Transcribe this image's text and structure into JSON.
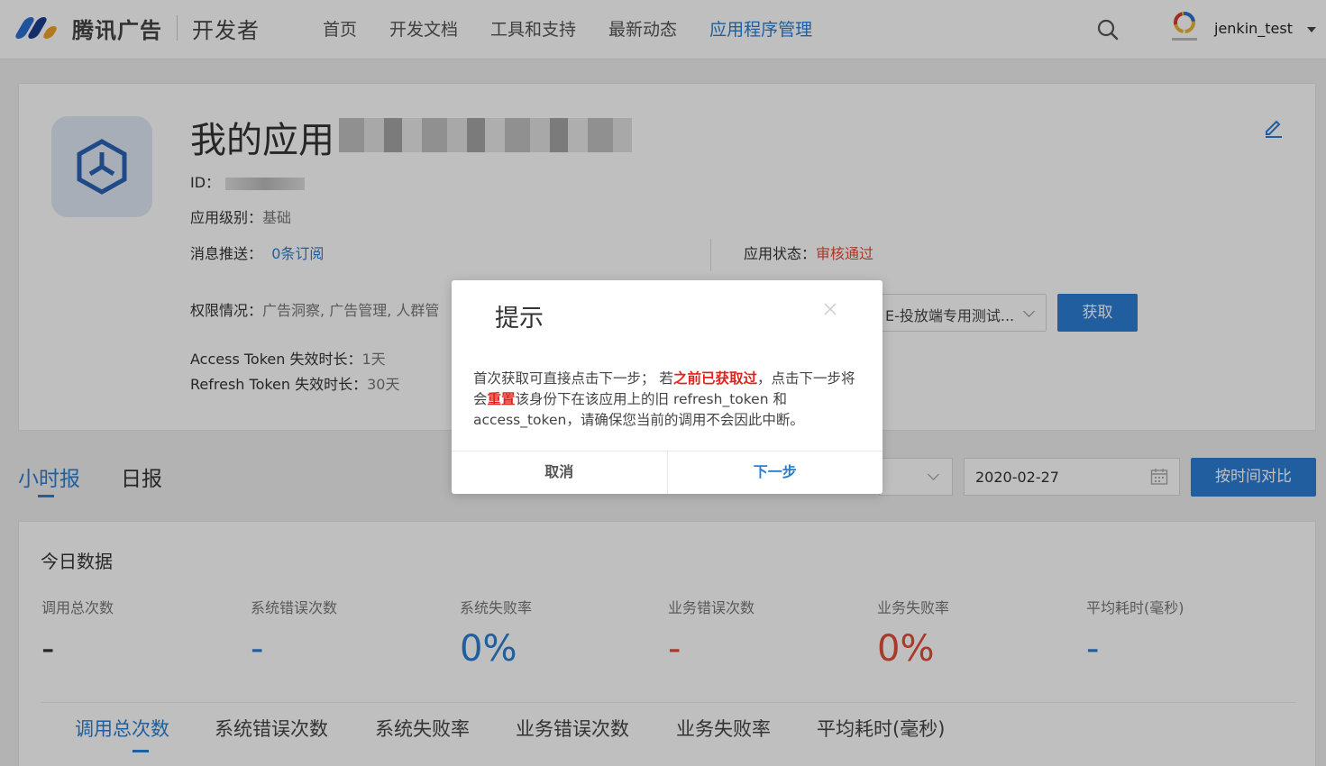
{
  "header": {
    "brand": "腾讯广告",
    "sub_brand": "开发者",
    "nav": [
      "首页",
      "开发文档",
      "工具和支持",
      "最新动态",
      "应用程序管理"
    ],
    "active_nav_index": 4,
    "username": "jenkin_test"
  },
  "app": {
    "title_prefix": "我的应用",
    "id_label": "ID：",
    "level_label": "应用级别：",
    "level_value": "基础",
    "push_label": "消息推送：",
    "push_value": "0条订阅",
    "status_label": "应用状态：",
    "status_value": "审核通过",
    "perm_label": "权限情况：",
    "perm_value": "广告洞察, 广告管理, 人群管",
    "account_select": "E-投放端专用测试...",
    "fetch_button": "获取",
    "access_token_label": "Access Token 失效时长：",
    "access_token_value": "1天",
    "refresh_token_label": "Refresh Token 失效时长：",
    "refresh_token_value": "30天"
  },
  "report": {
    "tabs": [
      "小时报",
      "日报"
    ],
    "date": "2020-02-27",
    "compare_button": "按时间对比",
    "card_title": "今日数据",
    "metrics": [
      {
        "label": "调用总次数",
        "value": "-",
        "color": "#333333"
      },
      {
        "label": "系统错误次数",
        "value": "-",
        "color": "#2a7fd3"
      },
      {
        "label": "系统失败率",
        "value": "0%",
        "color": "#2a7fd3"
      },
      {
        "label": "业务错误次数",
        "value": "-",
        "color": "#e34b3a"
      },
      {
        "label": "业务失败率",
        "value": "0%",
        "color": "#e34b3a"
      },
      {
        "label": "平均耗时(毫秒)",
        "value": "-",
        "color": "#2a7fd3"
      }
    ],
    "subtabs": [
      "调用总次数",
      "系统错误次数",
      "系统失败率",
      "业务错误次数",
      "业务失败率",
      "平均耗时(毫秒)"
    ]
  },
  "modal": {
    "title": "提示",
    "body_1": "首次获取可直接点击下一步； 若",
    "body_em1": "之前已获取过",
    "body_2": "，点击下一步将会",
    "body_em2": "重置",
    "body_3": "该身份下在该应用上的旧 refresh_token 和 access_token，请确保您当前的调用不会因此中断。",
    "cancel": "取消",
    "ok": "下一步"
  }
}
